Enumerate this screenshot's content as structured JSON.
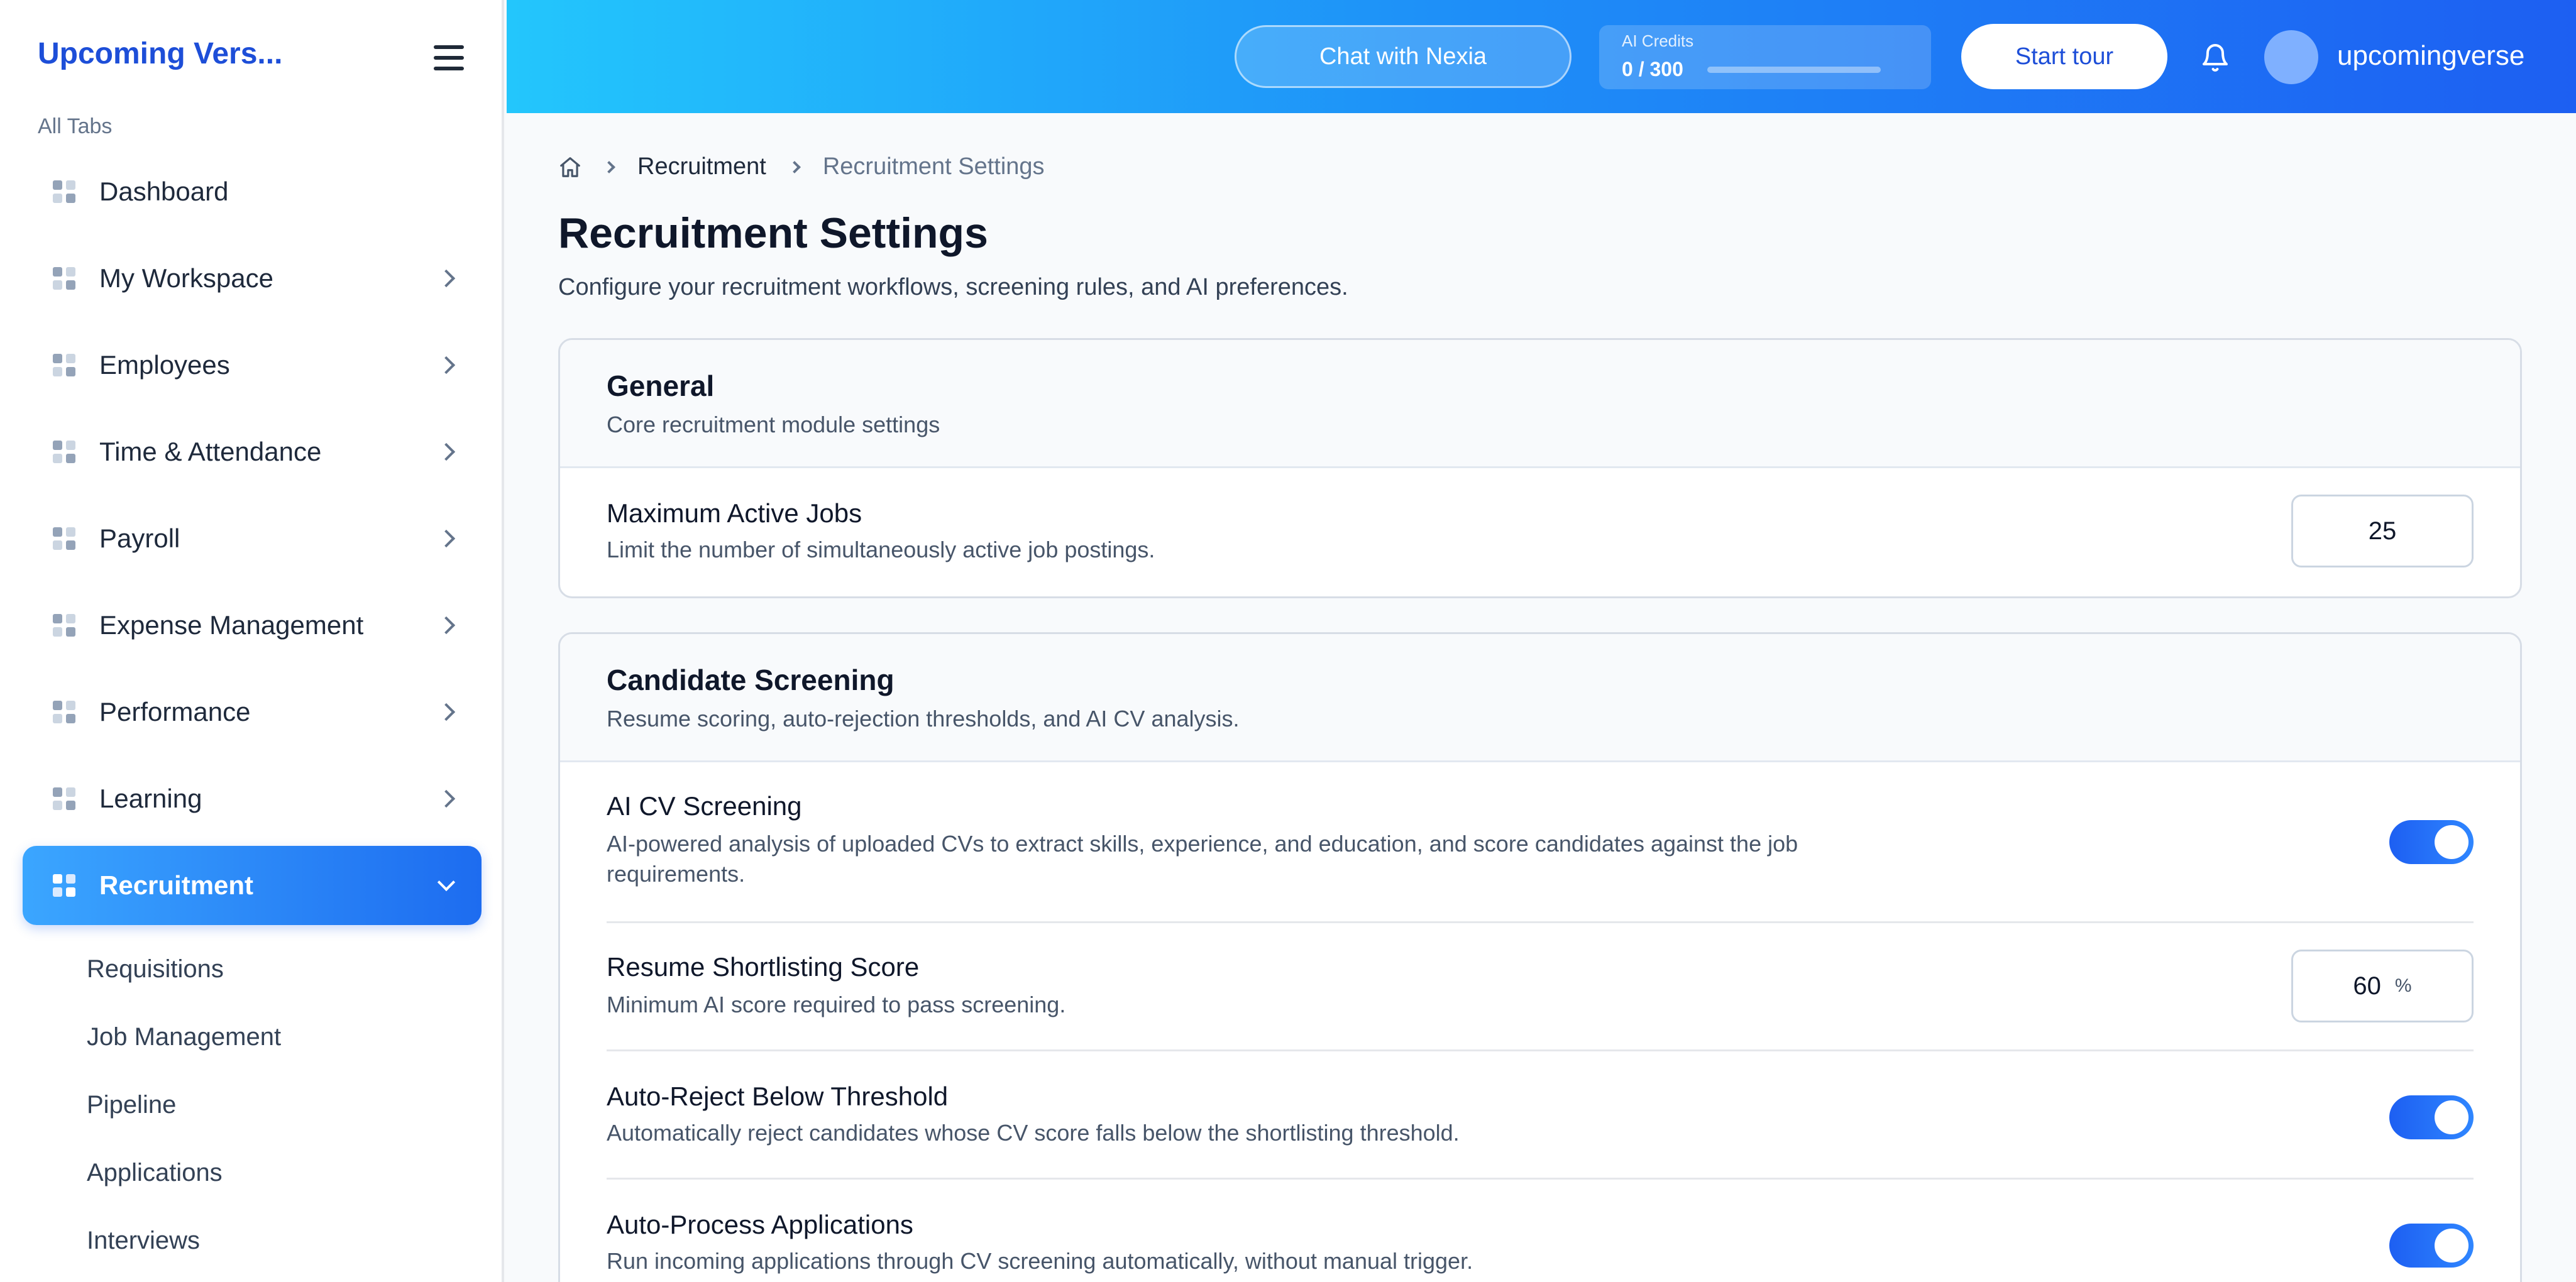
{
  "sidebar": {
    "brand": "Upcoming Vers...",
    "section_label": "All Tabs",
    "items": [
      {
        "label": "Dashboard"
      },
      {
        "label": "My Workspace"
      },
      {
        "label": "Employees"
      },
      {
        "label": "Time & Attendance"
      },
      {
        "label": "Payroll"
      },
      {
        "label": "Expense Management"
      },
      {
        "label": "Performance"
      },
      {
        "label": "Learning"
      },
      {
        "label": "Recruitment"
      }
    ],
    "sub_items": [
      {
        "label": "Requisitions"
      },
      {
        "label": "Job Management"
      },
      {
        "label": "Pipeline"
      },
      {
        "label": "Applications"
      },
      {
        "label": "Interviews"
      }
    ]
  },
  "header": {
    "chat_label": "Chat with Nexia",
    "credits_label": "AI Credits",
    "credits_value": "0 / 300",
    "credits_used_fraction": 0,
    "tour_label": "Start tour",
    "username": "upcomingverse"
  },
  "breadcrumb": {
    "parent": "Recruitment",
    "current": "Recruitment Settings"
  },
  "page": {
    "title": "Recruitment Settings",
    "subtitle": "Configure your recruitment workflows, screening rules, and AI preferences."
  },
  "general": {
    "title": "General",
    "desc": "Core recruitment module settings",
    "max_jobs": {
      "title": "Maximum Active Jobs",
      "desc": "Limit the number of simultaneously active job postings.",
      "value": "25"
    }
  },
  "screening": {
    "title": "Candidate Screening",
    "desc": "Resume scoring, auto-rejection thresholds, and AI CV analysis.",
    "ai_cv": {
      "title": "AI CV Screening",
      "desc": "AI-powered analysis of uploaded CVs to extract skills, experience, and education, and score candidates against the job requirements.",
      "enabled": true
    },
    "shortlist_score": {
      "title": "Resume Shortlisting Score",
      "desc": "Minimum AI score required to pass screening.",
      "value": "60",
      "unit": "%"
    },
    "auto_reject": {
      "title": "Auto-Reject Below Threshold",
      "desc": "Automatically reject candidates whose CV score falls below the shortlisting threshold.",
      "enabled": true
    },
    "auto_process": {
      "title": "Auto-Process Applications",
      "desc": "Run incoming applications through CV screening automatically, without manual trigger.",
      "enabled": true
    }
  },
  "colors": {
    "accent": "#1d5ff2",
    "brand": "#1d4ed8"
  }
}
